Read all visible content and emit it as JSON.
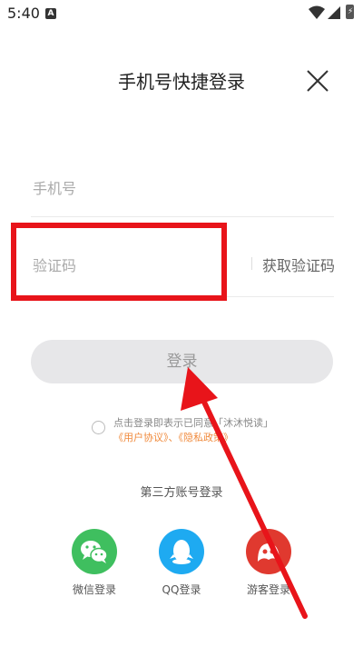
{
  "status_bar": {
    "time": "5:40",
    "notification_icon": "A",
    "battery_icon": "battery-charging-icon"
  },
  "header": {
    "title": "手机号快捷登录",
    "close_icon": "close-icon"
  },
  "form": {
    "phone_placeholder": "手机号",
    "code_placeholder": "验证码",
    "get_code_label": "获取验证码",
    "login_label": "登录"
  },
  "agreement": {
    "text": "点击登录即表示已同意「沐沐悦读」",
    "user_agreement": "《用户协议》",
    "separator": "、",
    "privacy_policy": "《隐私政策》"
  },
  "third_party": {
    "title": "第三方账号登录",
    "items": [
      {
        "label": "微信登录",
        "icon": "wechat-icon",
        "color": "#3fbf5f"
      },
      {
        "label": "QQ登录",
        "icon": "qq-icon",
        "color": "#1eaaf1"
      },
      {
        "label": "游客登录",
        "icon": "guest-icon",
        "color": "#e0392f"
      }
    ]
  },
  "annotation": {
    "highlight_color": "#e8141a"
  }
}
